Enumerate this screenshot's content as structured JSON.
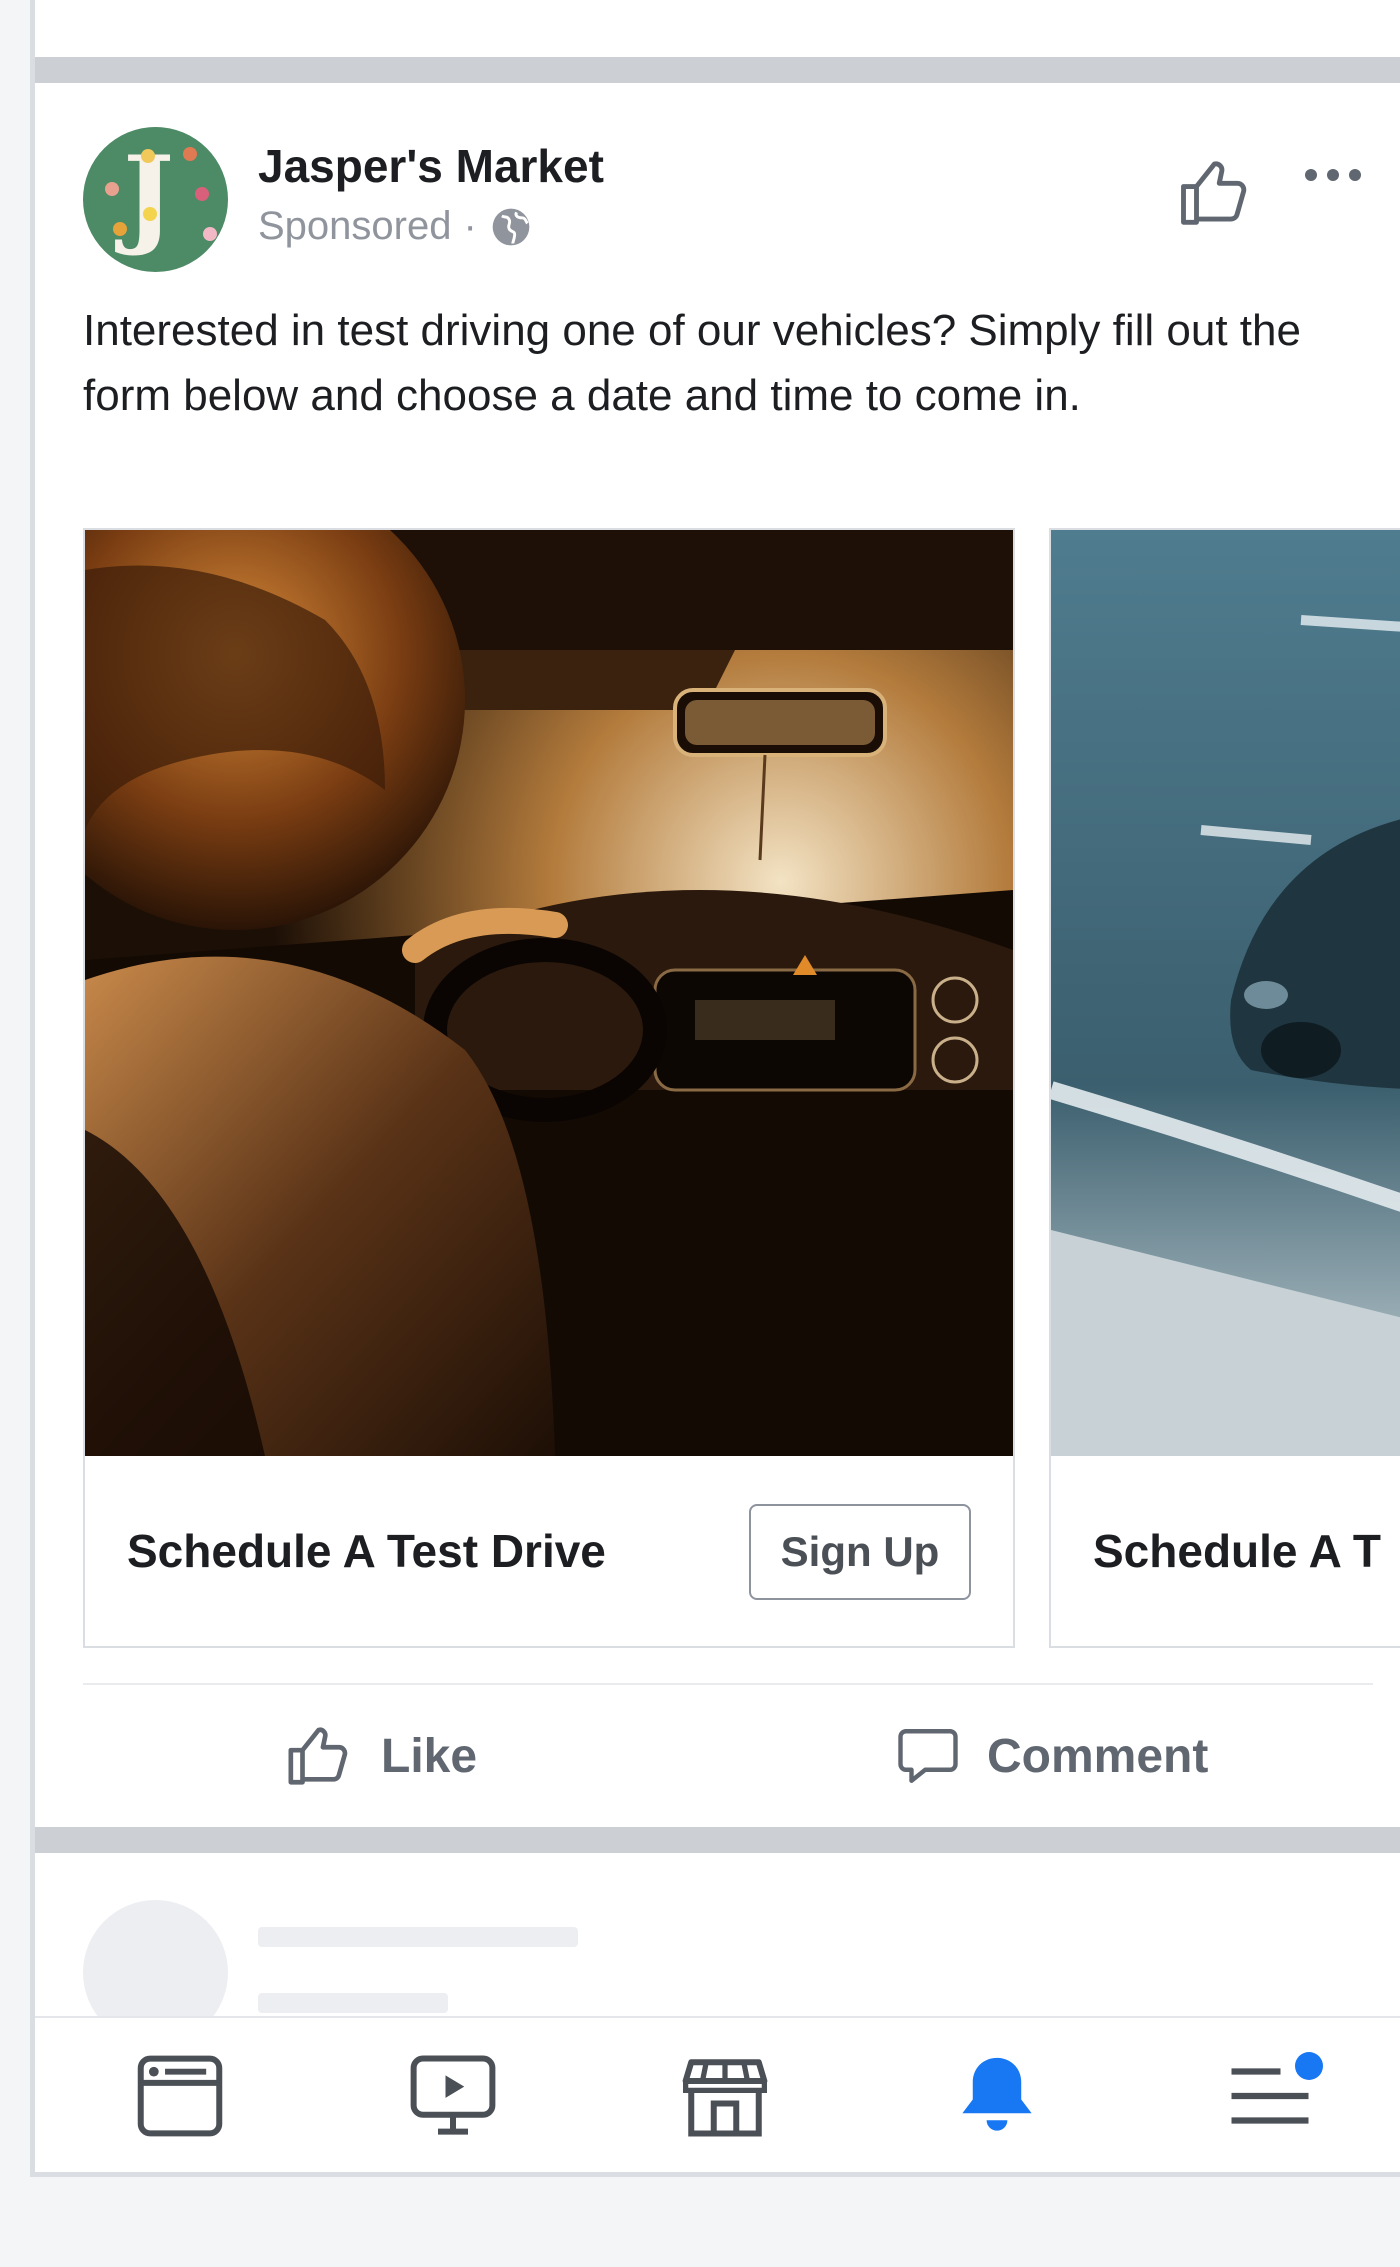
{
  "post": {
    "page_name": "Jasper's Market",
    "avatar_initial": "J",
    "sponsored_label": "Sponsored",
    "separator": "·",
    "body_text": "Interested in test driving one of our vehicles? Simply fill out the form below and choose a date and time to come in."
  },
  "carousel": {
    "cards": [
      {
        "title": "Schedule A Test Drive",
        "cta_label": "Sign Up",
        "image": "person-driving-car-photo"
      },
      {
        "title": "Schedule A T",
        "image": "car-on-road-photo"
      }
    ]
  },
  "actions": {
    "like_label": "Like",
    "comment_label": "Comment"
  },
  "bottom_nav": {
    "items": [
      "news-feed-icon",
      "watch-icon",
      "marketplace-icon",
      "notifications-icon",
      "menu-icon"
    ],
    "active_item": "notifications-icon",
    "menu_badge_color": "#1877f2"
  },
  "colors": {
    "brand_blue": "#1877f2",
    "secondary_text": "#90949c",
    "divider": "#ccd0d5"
  }
}
